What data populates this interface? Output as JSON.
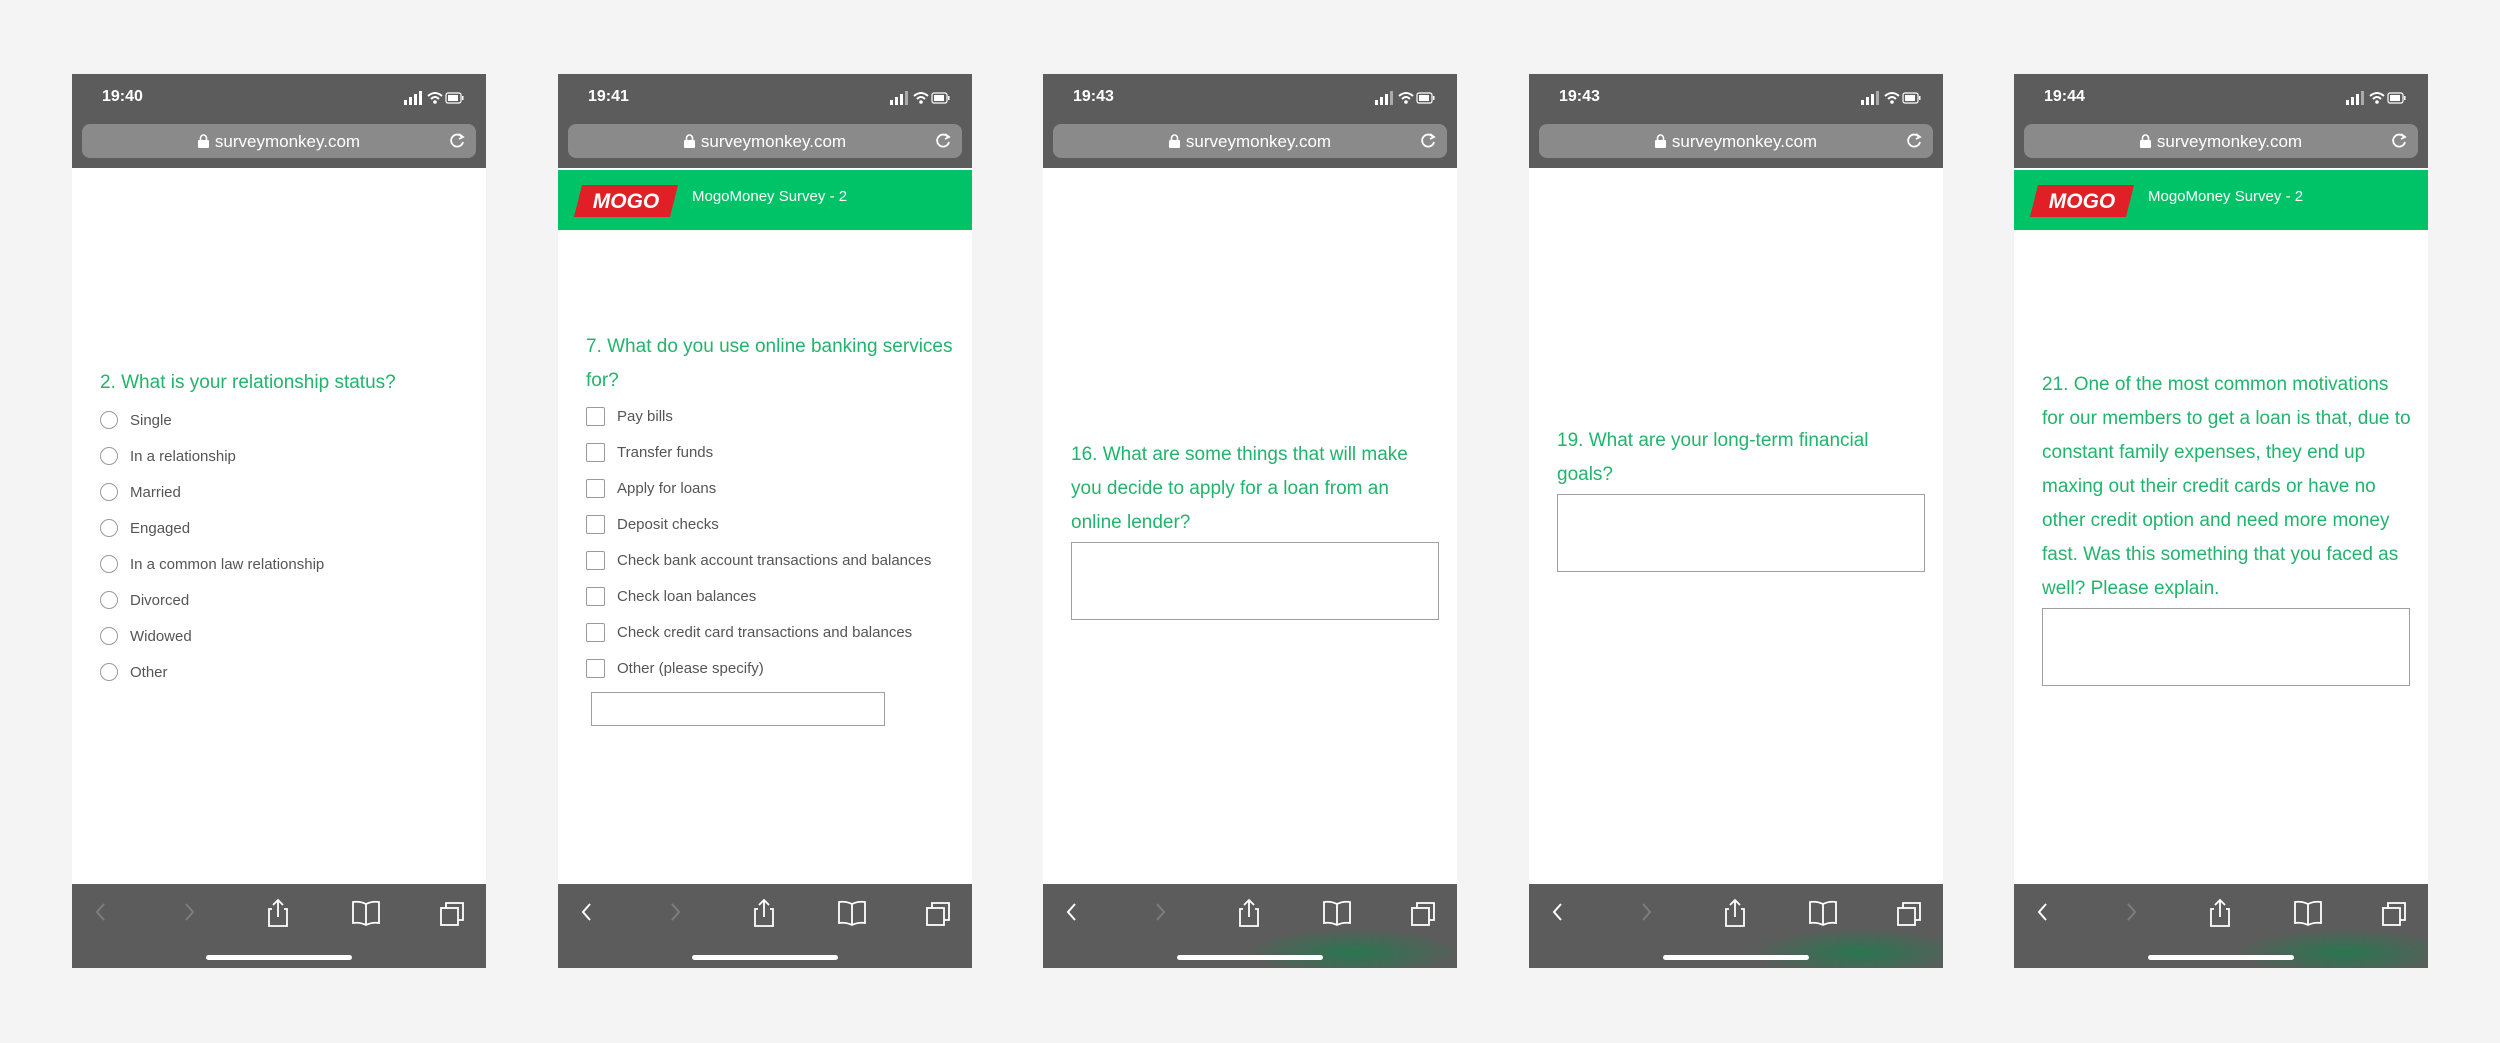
{
  "url": "surveymonkey.com",
  "banner": {
    "logo_text": "MOGO",
    "title": "MogoMoney Survey - 2"
  },
  "colors": {
    "accent_green": "#00c267",
    "question_green": "#22b46c",
    "chrome_gray": "#5c5c5c"
  },
  "icons": [
    "lock-icon",
    "reload-icon",
    "back-icon",
    "forward-icon",
    "share-icon",
    "bookmarks-icon",
    "tabs-icon"
  ],
  "screens": [
    {
      "time": "19:40",
      "question": "2. What is your relationship status?",
      "options": [
        "Single",
        "In a relationship",
        "Married",
        "Engaged",
        "In a common law relationship",
        "Divorced",
        "Widowed",
        "Other"
      ]
    },
    {
      "time": "19:41",
      "question": "7. What do you use online banking services for?",
      "options": [
        "Pay bills",
        "Transfer funds",
        "Apply for loans",
        "Deposit checks",
        "Check bank account transactions and balances",
        "Check loan balances",
        "Check credit card transactions and balances",
        "Other (please specify)"
      ]
    },
    {
      "time": "19:43",
      "question": "16. What are some things that will make you decide to apply for a loan from an online lender?"
    },
    {
      "time": "19:43",
      "question": "19. What are your long-term financial goals?"
    },
    {
      "time": "19:44",
      "question": "21. One of the most common motivations for our members to get a loan is that, due to constant family expenses, they end up maxing out their credit cards or have no other credit option and need more money fast. Was this something that you faced as well? Please explain."
    }
  ]
}
